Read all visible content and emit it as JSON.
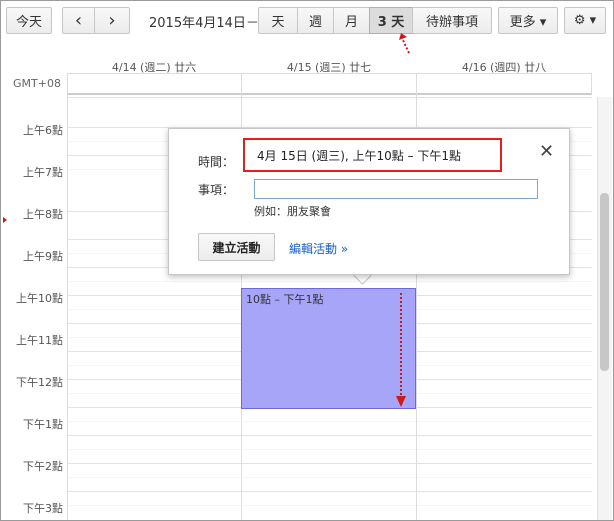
{
  "toolbar": {
    "today": "今天",
    "prev": "‹",
    "next": "›",
    "date_label": "2015年4月14日－",
    "views": [
      "天",
      "週",
      "月",
      "3 天",
      "待辦事項"
    ],
    "more": "更多 ▾",
    "settings": "⚙ ▾"
  },
  "timezone": "GMT+08",
  "days": [
    "4/14 (週二) 廿六",
    "4/15 (週三) 廿七",
    "4/16 (週四) 廿八"
  ],
  "hours": [
    "上午6點",
    "上午7點",
    "上午8點",
    "上午9點",
    "上午10點",
    "上午11點",
    "下午12點",
    "下午1點",
    "下午2點",
    "下午3點"
  ],
  "event": {
    "label": "10點 – 下午1點",
    "color": "#a7a5f8"
  },
  "popup": {
    "time_label": "時間：",
    "time_value": "4月 15日 (週三), 上午10點 – 下午1點",
    "title_label": "事項：",
    "title_value": "",
    "example": "例如：朋友聚會",
    "create_button": "建立活動",
    "edit_link": "編輯活動 »",
    "close": "✕"
  }
}
